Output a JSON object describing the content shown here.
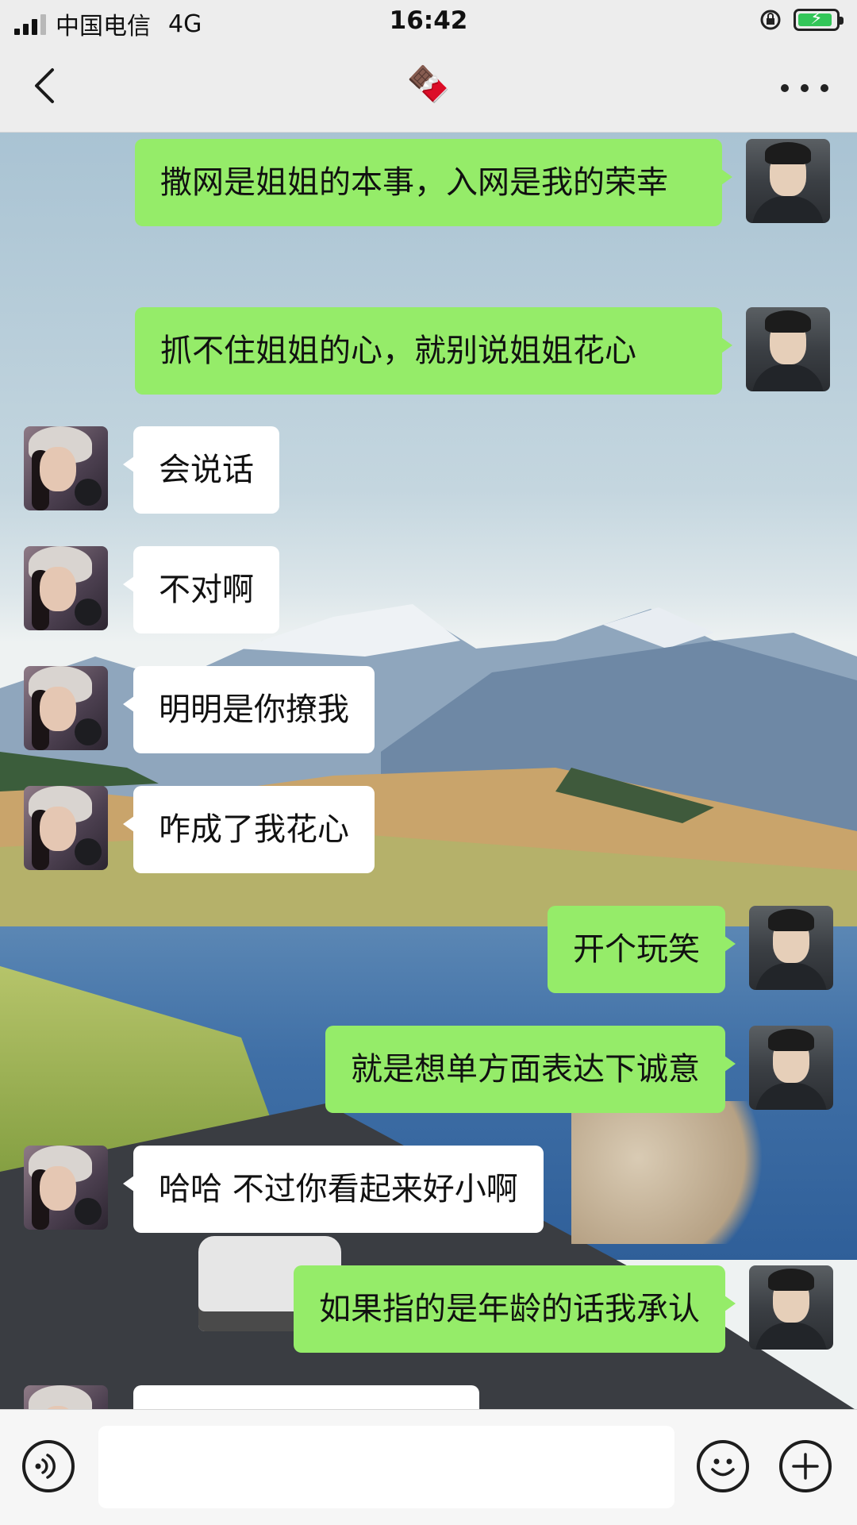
{
  "status_bar": {
    "carrier": "中国电信",
    "network": "4G",
    "time": "16:42"
  },
  "header": {
    "title_emoji": "🍫",
    "back_icon": "chevron-left-icon",
    "more_icon": "more-dots-icon"
  },
  "messages": [
    {
      "sender": "me",
      "text": "撒网是姐姐的本事，入网是我的荣幸"
    },
    {
      "sender": "me",
      "text": "抓不住姐姐的心，就别说姐姐花心"
    },
    {
      "sender": "her",
      "text": "会说话"
    },
    {
      "sender": "her",
      "text": "不对啊"
    },
    {
      "sender": "her",
      "text": "明明是你撩我"
    },
    {
      "sender": "her",
      "text": "咋成了我花心"
    },
    {
      "sender": "me",
      "text": "开个玩笑"
    },
    {
      "sender": "me",
      "text": "就是想单方面表达下诚意"
    },
    {
      "sender": "her",
      "text": "哈哈 不过你看起来好小啊"
    },
    {
      "sender": "me",
      "text": "如果指的是年龄的话我承认"
    }
  ],
  "input_bar": {
    "voice_icon": "voice-icon",
    "emoji_icon": "emoji-icon",
    "plus_icon": "plus-icon",
    "input_value": ""
  },
  "colors": {
    "my_bubble": "#95ec69",
    "their_bubble": "#ffffff",
    "chrome_bg": "#ededed",
    "battery_fill": "#33c659"
  }
}
